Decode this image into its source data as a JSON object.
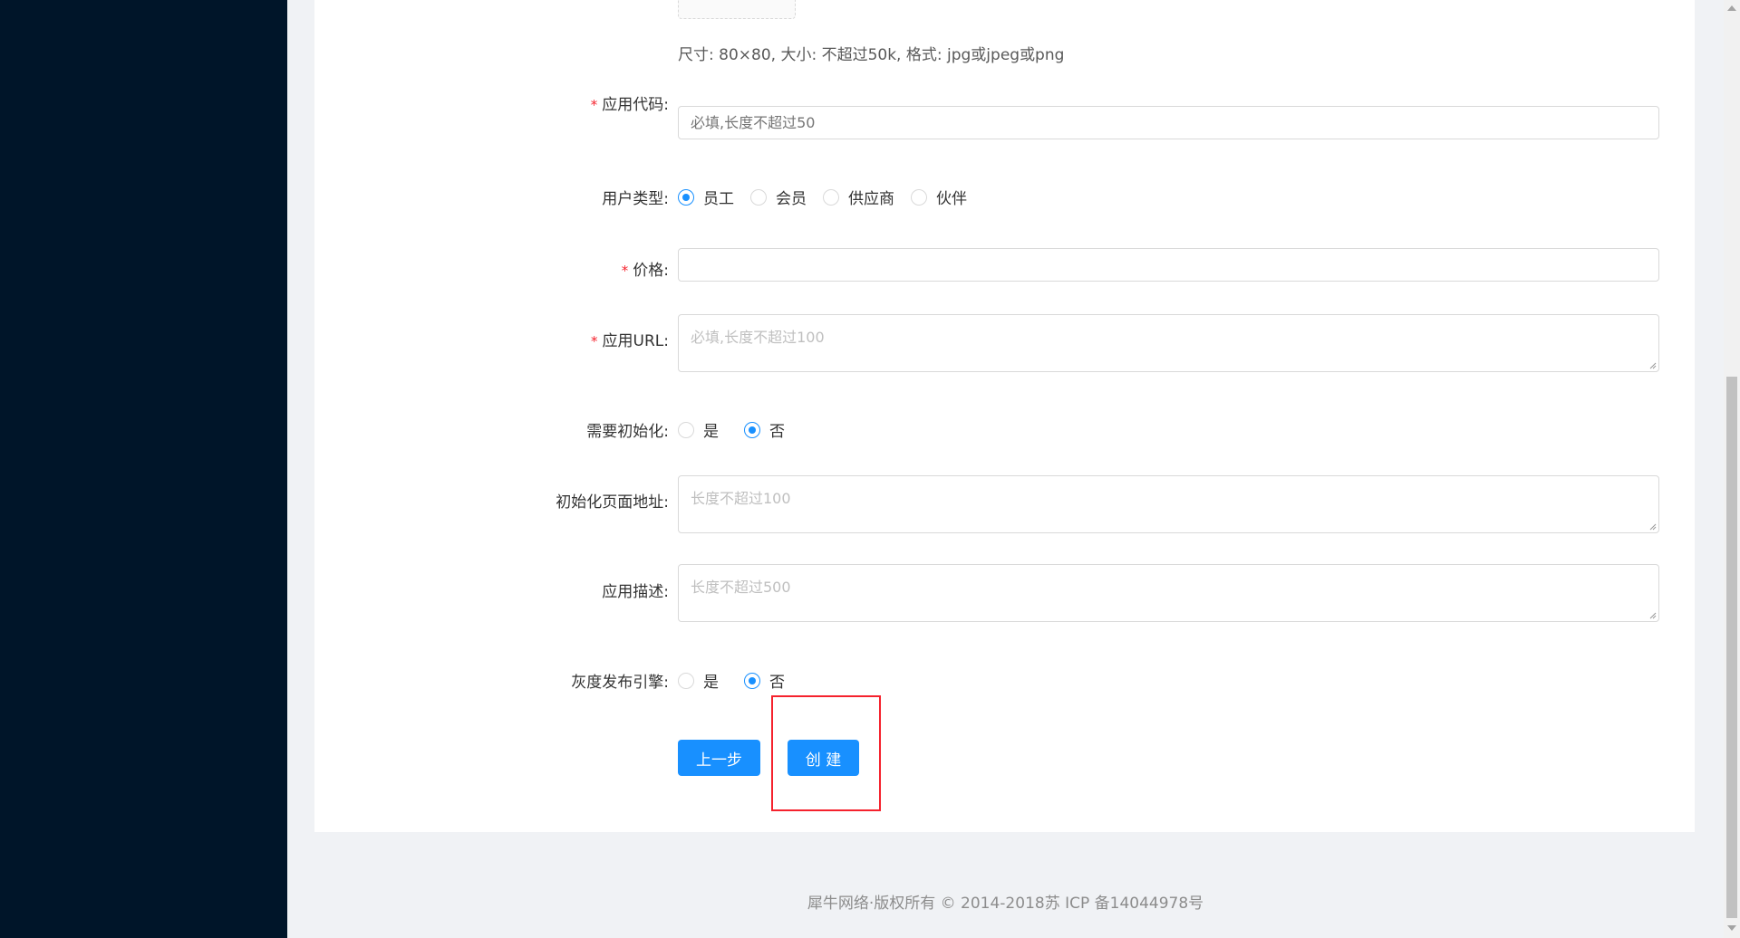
{
  "upload": {
    "hint": "尺寸: 80×80, 大小: 不超过50k, 格式: jpg或jpeg或png"
  },
  "form": {
    "app_code": {
      "label": "应用代码:",
      "placeholder": "必填,长度不超过50",
      "required": true
    },
    "user_type": {
      "label": "用户类型:",
      "options": [
        "员工",
        "会员",
        "供应商",
        "伙伴"
      ],
      "selected": "员工"
    },
    "price": {
      "label": "价格:",
      "value": "",
      "required": true
    },
    "app_url": {
      "label": "应用URL:",
      "placeholder": "必填,长度不超过100",
      "required": true
    },
    "need_init": {
      "label": "需要初始化:",
      "options": [
        "是",
        "否"
      ],
      "selected": "否"
    },
    "init_page_url": {
      "label": "初始化页面地址:",
      "placeholder": "长度不超过100"
    },
    "app_desc": {
      "label": "应用描述:",
      "placeholder": "长度不超过500"
    },
    "gray_release": {
      "label": "灰度发布引擎:",
      "options": [
        "是",
        "否"
      ],
      "selected": "否"
    },
    "required_mark": "*"
  },
  "buttons": {
    "prev_label": "上一步",
    "create_label": "创 建"
  },
  "footer": {
    "copyright": "犀牛网络·版权所有 © 2014-2018苏 ICP 备14044978号"
  },
  "colors": {
    "sidebar": "#001529",
    "primary": "#1890ff",
    "required": "#f5222d",
    "highlight": "#f5222d"
  }
}
